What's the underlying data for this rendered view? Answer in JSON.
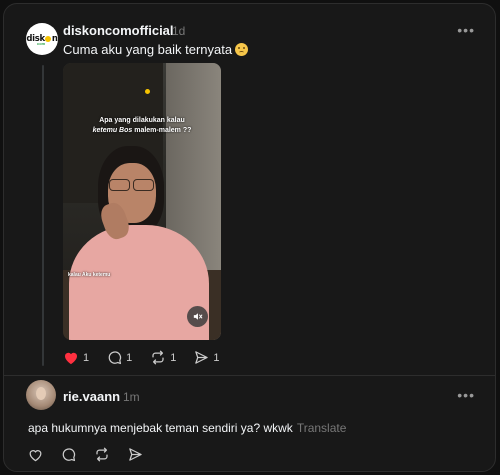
{
  "post": {
    "username": "diskoncomofficial",
    "time": "1d",
    "more_label": "•••",
    "caption": "Cuma aku yang baik ternyata",
    "avatar_logo": "disk",
    "avatar_logo_end": "n",
    "avatar_logo_sub": "com",
    "video": {
      "overlay_line1": "Apa yang dilakukan kalau",
      "overlay_line2_a": "ketemu Bos",
      "overlay_line2_b": "malem-malem ??",
      "overlay_sub": "kalau Aku ketemu",
      "mute_icon": "speaker-muted-icon"
    },
    "actions": {
      "like_count": "1",
      "comment_count": "1",
      "repost_count": "1",
      "share_count": "1",
      "like_color": "#ff3040"
    }
  },
  "reply": {
    "username": "rie.vaann",
    "time": "1m",
    "more_label": "•••",
    "text": "apa hukumnya menjebak teman sendiri ya? wkwk",
    "translate_label": "Translate"
  }
}
